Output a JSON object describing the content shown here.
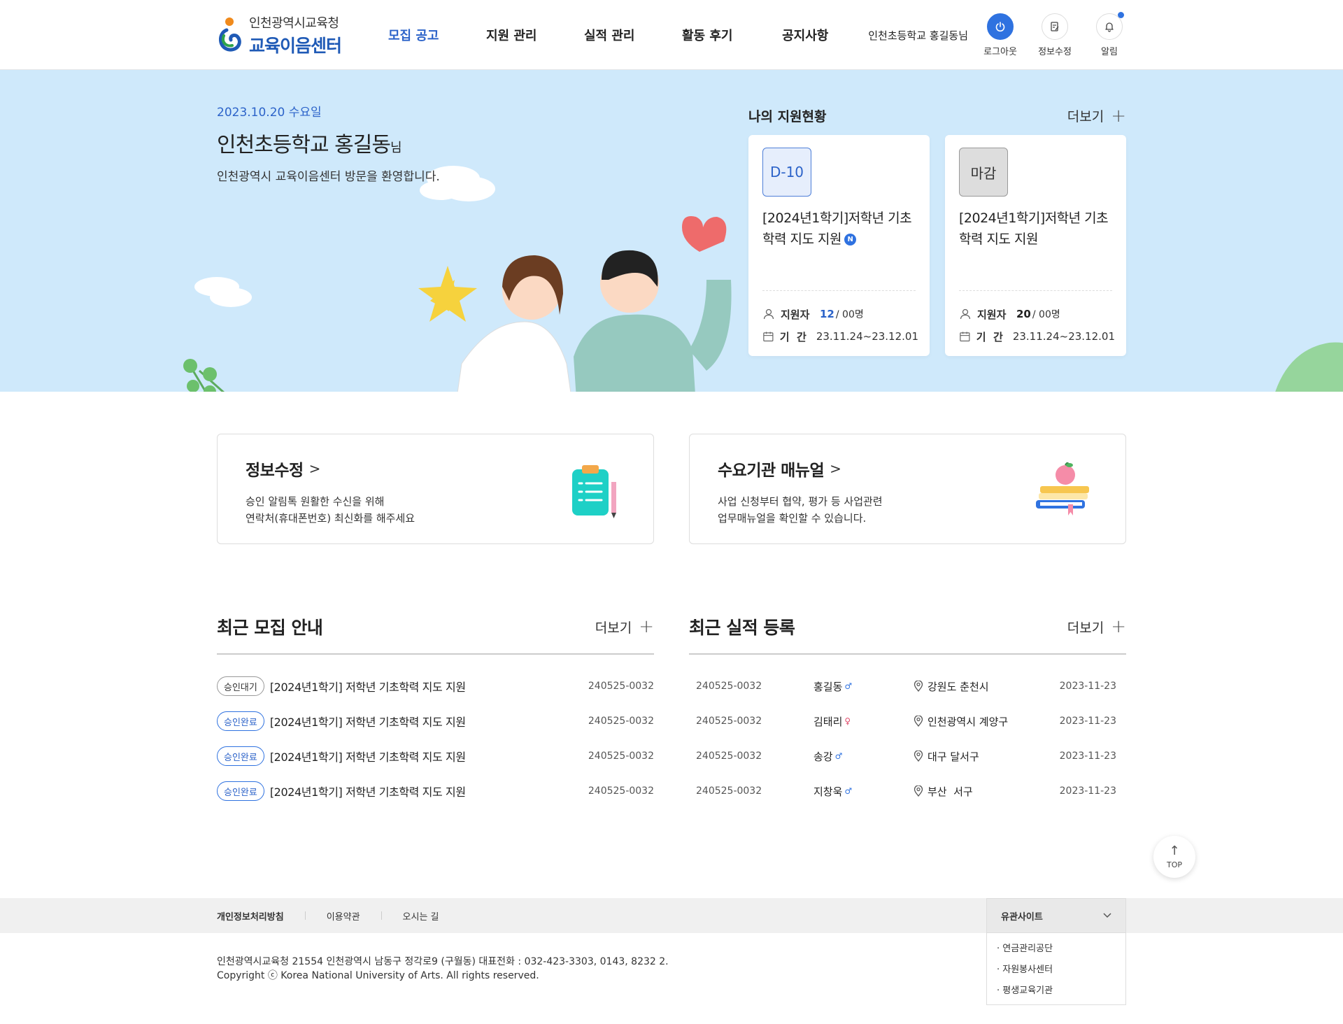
{
  "header": {
    "logo_top": "인천광역시교육청",
    "logo_bottom": "교육이음센터",
    "nav": [
      "모집 공고",
      "지원 관리",
      "실적 관리",
      "활동 후기",
      "공지사항"
    ],
    "active_nav": 0,
    "user": "인천초등학교 홍길동님",
    "util": [
      {
        "label": "로그아웃",
        "icon": "power-icon"
      },
      {
        "label": "정보수정",
        "icon": "edit-doc-icon"
      },
      {
        "label": "알림",
        "icon": "bell-icon"
      }
    ]
  },
  "hero": {
    "date": "2023.10.20 수요일",
    "name": "인천초등학교 홍길동",
    "name_suffix": "님",
    "welcome": "인천광역시 교육이음센터 방문을 환영합니다.",
    "status_title": "나의 지원현황",
    "more": "더보기",
    "cards": [
      {
        "badge": "D-10",
        "title": "[2024년1학기]저학년 기초학력 지도 지원",
        "new": "N",
        "applicants_label": "지원자",
        "applicants": "12",
        "total": "00명",
        "period_label": "기  간",
        "period": "23.11.24~23.12.01"
      },
      {
        "badge": "마감",
        "title": "[2024년1학기]저학년 기초학력 지도 지원",
        "applicants_label": "지원자",
        "applicants": "20",
        "total": "00명",
        "period_label": "기  간",
        "period": "23.11.24~23.12.01"
      }
    ]
  },
  "quick": [
    {
      "title": "정보수정",
      "desc": "승인 알림톡 원활한 수신을 위해\n연락처(휴대폰번호) 최신화를 해주세요",
      "icon": "clipboard-icon"
    },
    {
      "title": "수요기관 매뉴얼",
      "desc": "사업 신청부터 협약, 평가 등 사업관련\n업무매뉴얼을 확인할 수 있습니다.",
      "icon": "books-icon"
    }
  ],
  "recruit": {
    "title": "최근 모집 안내",
    "more": "더보기",
    "items": [
      {
        "status": "승인대기",
        "kind": "wait",
        "title": "[2024년1학기] 저학년 기초학력 지도 지원",
        "code": "240525-0032"
      },
      {
        "status": "승인완료",
        "kind": "done",
        "title": "[2024년1학기] 저학년 기초학력 지도 지원",
        "code": "240525-0032"
      },
      {
        "status": "승인완료",
        "kind": "done",
        "title": "[2024년1학기] 저학년 기초학력 지도 지원",
        "code": "240525-0032"
      },
      {
        "status": "승인완료",
        "kind": "done",
        "title": "[2024년1학기] 저학년 기초학력 지도 지원",
        "code": "240525-0032"
      }
    ]
  },
  "performance": {
    "title": "최근 실적 등록",
    "more": "더보기",
    "items": [
      {
        "code": "240525-0032",
        "name": "홍길동",
        "sex": "♂",
        "sexk": "m",
        "region": "강원도 춘천시",
        "date": "2023-11-23"
      },
      {
        "code": "240525-0032",
        "name": "김태리",
        "sex": "♀",
        "sexk": "f",
        "region": "인천광역시 계양구",
        "date": "2023-11-23"
      },
      {
        "code": "240525-0032",
        "name": "송강",
        "sex": "♂",
        "sexk": "m",
        "region": "대구 달서구",
        "date": "2023-11-23"
      },
      {
        "code": "240525-0032",
        "name": "지창욱",
        "sex": "♂",
        "sexk": "m",
        "region": "부산  서구",
        "date": "2023-11-23"
      }
    ]
  },
  "top_label": "TOP",
  "footer": {
    "links": [
      "개인정보처리방침",
      "이용약관",
      "오시는 길"
    ],
    "family_title": "유관사이트",
    "family_links": [
      "연금관리공단",
      "자원봉사센터",
      "평생교육기관"
    ],
    "address": "인천광역시교육청 21554 인천광역시 남동구 정각로9 (구월동) 대표전화 : 032-423-3303, 0143, 8232 2.",
    "copyright": "Copyright ⓒ Korea National University of Arts. All rights reserved."
  },
  "colors": {
    "primary": "#2c63c9",
    "hero_bg": "#cfe9fb"
  }
}
